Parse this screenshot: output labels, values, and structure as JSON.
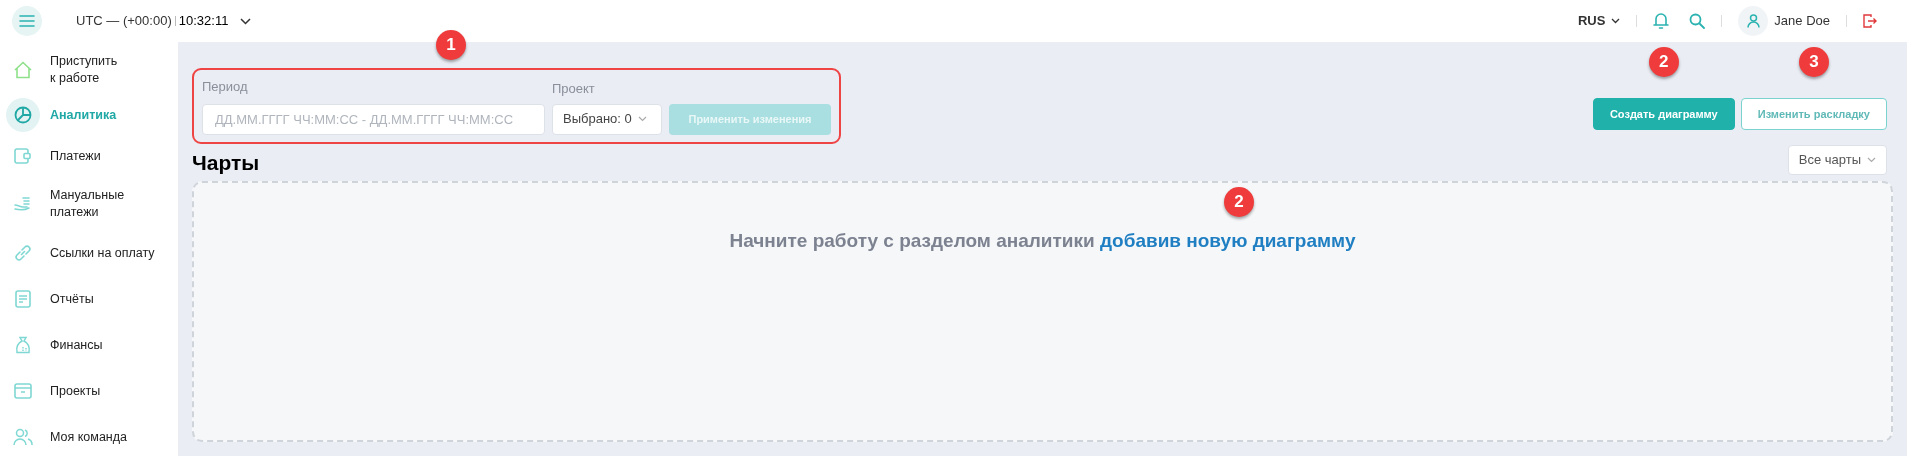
{
  "header": {
    "timezone": "UTC — (+00:00)",
    "time": "10:32:11",
    "language": "RUS",
    "user": "Jane Doe"
  },
  "sidebar": {
    "items": [
      {
        "label": "Приступить\nк работе",
        "selected": false
      },
      {
        "label": "Аналитика",
        "selected": true
      },
      {
        "label": "Платежи",
        "selected": false
      },
      {
        "label": "Мануальные\nплатежи",
        "selected": false
      },
      {
        "label": "Ссылки на оплату",
        "selected": false
      },
      {
        "label": "Отчёты",
        "selected": false
      },
      {
        "label": "Финансы",
        "selected": false
      },
      {
        "label": "Проекты",
        "selected": false
      },
      {
        "label": "Моя команда",
        "selected": false
      }
    ]
  },
  "filters": {
    "badge": "1",
    "period_label": "Период",
    "period_placeholder": "ДД.ММ.ГГГГ ЧЧ:ММ:СС - ДД.ММ.ГГГГ ЧЧ:ММ:СС",
    "project_label": "Проект",
    "project_value": "Выбрано: 0",
    "apply_button": {
      "label": "Применить изменения",
      "disabled": true
    }
  },
  "actions": [
    {
      "label": "Создать диаграмму",
      "badge": "2",
      "kind": "primary"
    },
    {
      "label": "Изменить раскладку",
      "badge": "3",
      "kind": "outline"
    }
  ],
  "charts": {
    "title": "Чарты",
    "filter": "Все чарты",
    "badge": "2",
    "empty_text": "Начните работу с разделом аналитики",
    "empty_link": "добавив новую диаграмму"
  }
}
